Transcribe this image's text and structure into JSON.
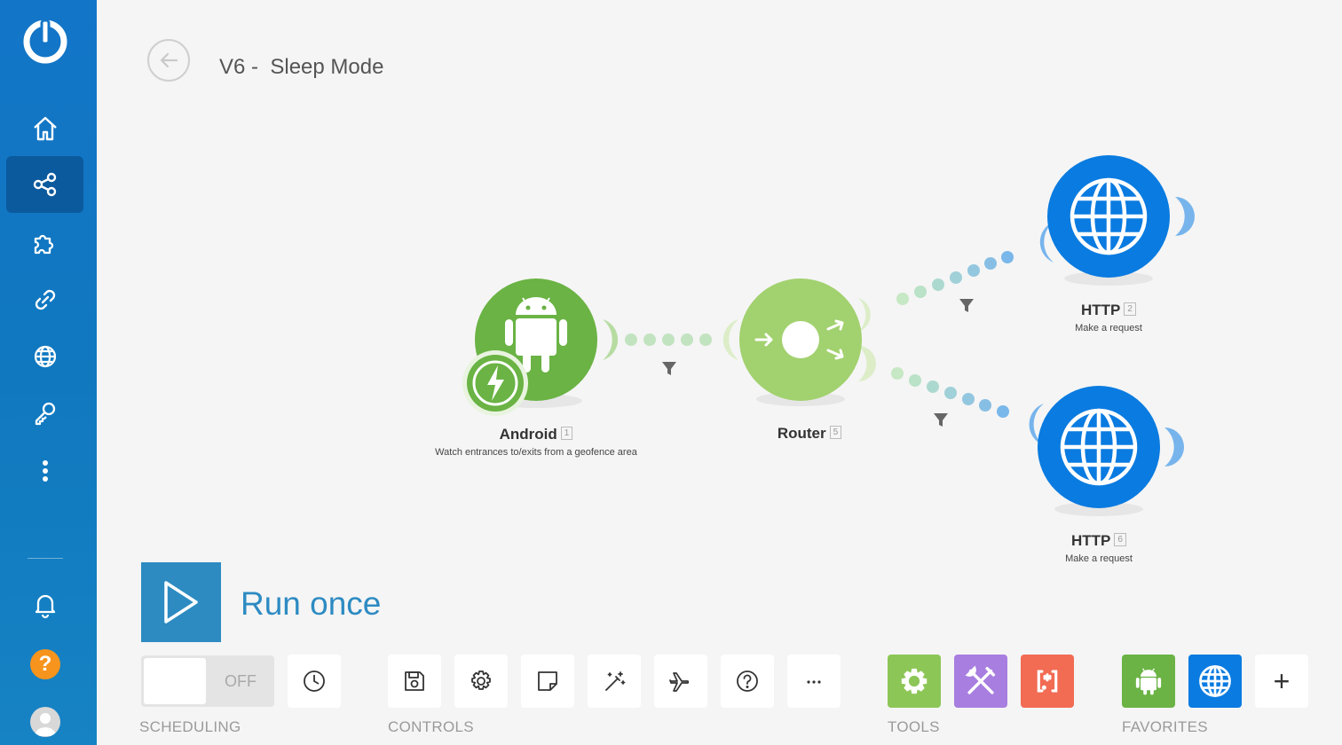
{
  "header": {
    "title": "V6 -  Sleep Mode"
  },
  "sidebar": {
    "items": [
      {
        "name": "home"
      },
      {
        "name": "scenarios"
      },
      {
        "name": "templates"
      },
      {
        "name": "connections"
      },
      {
        "name": "webhooks"
      },
      {
        "name": "keys"
      },
      {
        "name": "more"
      }
    ],
    "help_label": "?"
  },
  "modules": [
    {
      "name": "Android",
      "index": "1",
      "description": "Watch entrances to/exits from a geofence area",
      "color": "#6ab344"
    },
    {
      "name": "Router",
      "index": "5",
      "description": "",
      "color": "#a2d16f"
    },
    {
      "name": "HTTP",
      "index": "2",
      "description": "Make a request",
      "color": "#0a7be0"
    },
    {
      "name": "HTTP",
      "index": "6",
      "description": "Make a request",
      "color": "#0a7be0"
    }
  ],
  "run": {
    "label": "Run once"
  },
  "scheduling": {
    "toggle_state": "OFF",
    "group_label": "SCHEDULING"
  },
  "controls": {
    "group_label": "CONTROLS"
  },
  "tools": {
    "group_label": "TOOLS",
    "colors": [
      "#8cc656",
      "#a87ee0",
      "#f26b53"
    ]
  },
  "favorites": {
    "group_label": "FAVORITES",
    "add_label": "+"
  }
}
